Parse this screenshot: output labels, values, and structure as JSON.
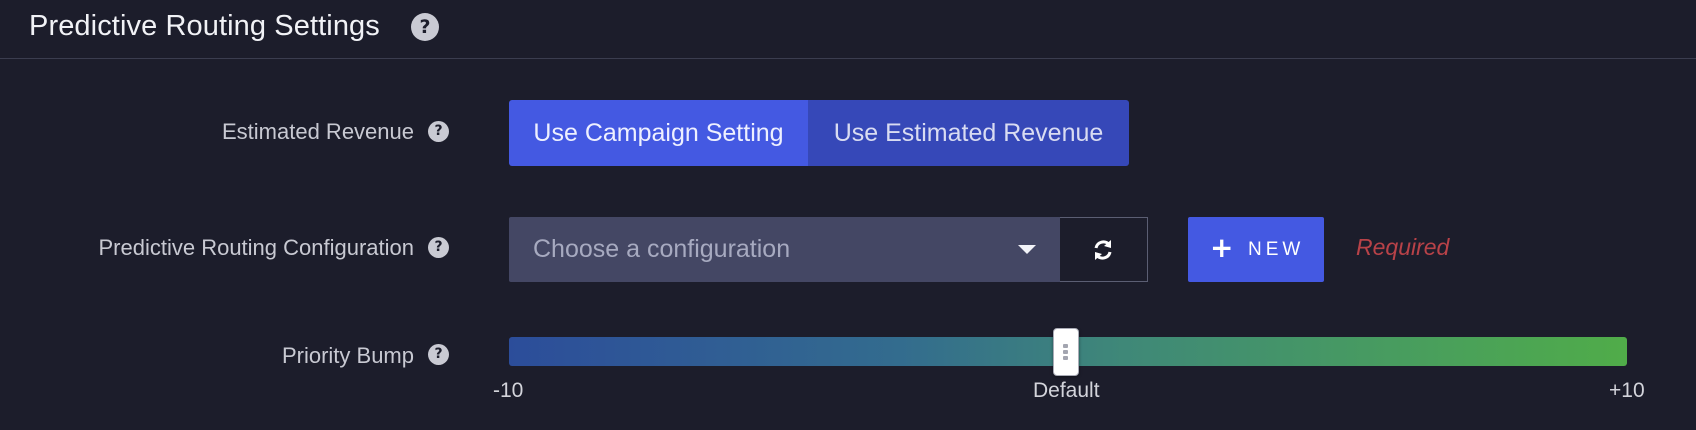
{
  "header": {
    "title": "Predictive Routing Settings",
    "help_icon": "question-circle-icon"
  },
  "estimated_revenue": {
    "label": "Estimated Revenue",
    "options": [
      "Use Campaign Setting",
      "Use Estimated Revenue"
    ],
    "selected": "Use Campaign Setting"
  },
  "routing_config": {
    "label": "Predictive Routing Configuration",
    "placeholder": "Choose a configuration",
    "refresh_icon": "refresh-icon",
    "new_button": {
      "icon": "+",
      "label": "NEW"
    },
    "required_text": "Required"
  },
  "priority_bump": {
    "label": "Priority Bump",
    "min_label": "-10",
    "mid_label": "Default",
    "max_label": "+10",
    "min": -10,
    "max": 10,
    "value": 0
  },
  "colors": {
    "background": "#1c1d2b",
    "accent": "#4459e2",
    "required": "#b84248",
    "slider_start": "#2c4d9a",
    "slider_end": "#50ac49"
  }
}
